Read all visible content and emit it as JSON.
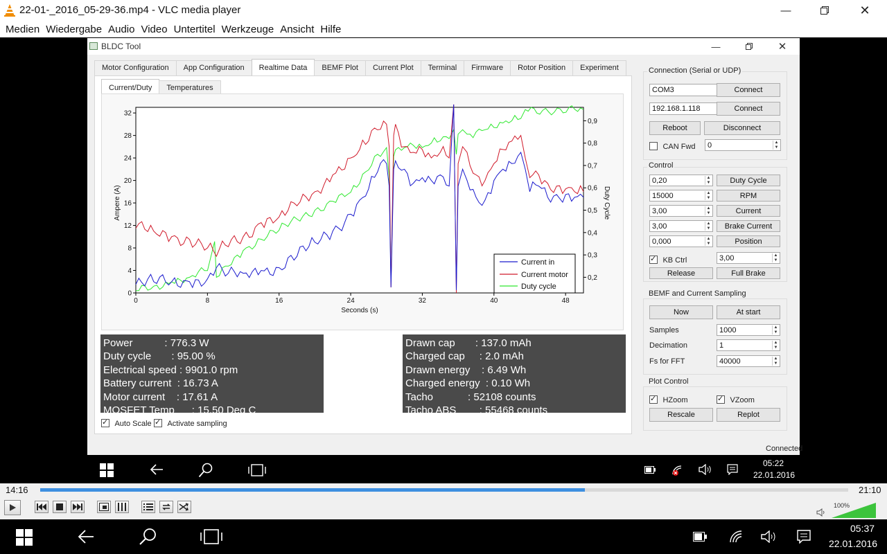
{
  "vlc": {
    "title": "22-01-_2016_05-29-36.mp4 - VLC media player",
    "menu": [
      "Medien",
      "Wiedergabe",
      "Audio",
      "Video",
      "Untertitel",
      "Werkzeuge",
      "Ansicht",
      "Hilfe"
    ],
    "time_elapsed": "14:16",
    "time_total": "21:10",
    "progress_fraction": 0.674,
    "volume_label": "100%",
    "volume_fraction": 1.0
  },
  "bldc": {
    "title": "BLDC Tool",
    "main_tabs": [
      "Motor Configuration",
      "App Configuration",
      "Realtime Data",
      "BEMF Plot",
      "Current Plot",
      "Terminal",
      "Firmware",
      "Rotor Position",
      "Experiment"
    ],
    "active_main_tab": "Realtime Data",
    "sub_tabs": [
      "Current/Duty",
      "Temperatures"
    ],
    "active_sub_tab": "Current/Duty",
    "stats_left": [
      "Power           : 776.3 W",
      "Duty cycle       : 95.00 %",
      "Electrical speed : 9901.0 rpm",
      "Battery current  : 16.73 A",
      "Motor current    : 17.61 A",
      "MOSFET Temp      : 15.50 Deg C"
    ],
    "stats_right": [
      "Drawn cap       : 137.0 mAh",
      "Charged cap     : 2.0 mAh",
      "Drawn energy    : 6.49 Wh",
      "Charged energy  : 0.10 Wh",
      "Tacho            : 52108 counts",
      "Tacho ABS        : 55468 counts"
    ],
    "auto_scale_label": "Auto Scale",
    "activate_sampling_label": "Activate sampling",
    "connection": {
      "title": "Connection (Serial or UDP)",
      "port_value": "COM3",
      "ip_value": "192.168.1.118",
      "connect_label": "Connect",
      "reboot_label": "Reboot",
      "disconnect_label": "Disconnect",
      "can_fwd_label": "CAN Fwd",
      "can_fwd_value": "0"
    },
    "control": {
      "title": "Control",
      "rows": [
        {
          "value": "0,20",
          "button": "Duty Cycle"
        },
        {
          "value": "15000",
          "button": "RPM"
        },
        {
          "value": "3,00",
          "button": "Current"
        },
        {
          "value": "3,00",
          "button": "Brake Current"
        },
        {
          "value": "0,000",
          "button": "Position"
        }
      ],
      "kb_ctrl_label": "KB Ctrl",
      "kb_ctrl_value": "3,00",
      "release_label": "Release",
      "full_brake_label": "Full Brake"
    },
    "sampling": {
      "title": "BEMF and Current Sampling",
      "now_label": "Now",
      "at_start_label": "At start",
      "samples_label": "Samples",
      "samples_value": "1000",
      "decimation_label": "Decimation",
      "decimation_value": "1",
      "fs_label": "Fs for FFT",
      "fs_value": "40000"
    },
    "plot_control": {
      "title": "Plot Control",
      "hzoom_label": "HZoom",
      "vzoom_label": "VZoom",
      "rescale_label": "Rescale",
      "replot_label": "Replot"
    },
    "status": "Connected"
  },
  "inner_taskbar": {
    "time": "05:22",
    "date": "22.01.2016"
  },
  "win_taskbar": {
    "time": "05:37",
    "date": "22.01.2016"
  },
  "colors": {
    "current_in": "#1a1acd",
    "current_motor": "#d01a2a",
    "duty_cycle": "#2ee82e",
    "seek": "#3d8fe0"
  },
  "chart_data": {
    "type": "line",
    "xlabel": "Seconds (s)",
    "ylabel": "Ampere (A)",
    "y2label": "Duty Cycle",
    "xlim": [
      0,
      50
    ],
    "ylim": [
      0,
      33
    ],
    "y2lim": [
      0.13,
      0.96
    ],
    "x_ticks": [
      "0",
      "8",
      "16",
      "24",
      "32",
      "40",
      "48"
    ],
    "y_ticks": [
      "0",
      "4",
      "8",
      "12",
      "16",
      "20",
      "24",
      "28",
      "32"
    ],
    "y2_ticks": [
      "0,2",
      "0,3",
      "0,4",
      "0,5",
      "0,6",
      "0,7",
      "0,8",
      "0,9"
    ],
    "series": [
      {
        "name": "Current in",
        "axis": "left",
        "x": [
          0,
          2,
          4,
          6,
          8,
          9,
          10,
          12,
          14,
          16,
          18,
          20,
          22,
          24,
          25,
          26,
          27,
          28,
          28.3,
          28.5,
          28.8,
          29,
          30,
          31,
          32,
          33,
          34,
          35,
          35.5,
          35.8,
          36,
          36.5,
          37,
          38,
          39,
          40,
          41,
          42,
          43,
          43.5,
          44,
          45,
          46,
          47,
          48,
          49,
          50
        ],
        "y": [
          1.5,
          2,
          2,
          2,
          2.5,
          4.5,
          3,
          3.5,
          4,
          4.5,
          6.5,
          9,
          11,
          14,
          16.5,
          18.5,
          21.5,
          23,
          19,
          1,
          22,
          23.5,
          22,
          19.5,
          20.5,
          20,
          21,
          19,
          33.5,
          0.5,
          19,
          22,
          20,
          17,
          16.5,
          20,
          22,
          23,
          25,
          22,
          18,
          19,
          17,
          17.5,
          17.5,
          17,
          17
        ]
      },
      {
        "name": "Current motor",
        "axis": "left",
        "x": [
          0,
          2,
          4,
          6,
          8,
          9,
          10,
          12,
          14,
          16,
          18,
          20,
          22,
          24,
          25,
          26,
          27,
          28,
          28.3,
          28.5,
          28.8,
          29,
          30,
          31,
          32,
          33,
          34,
          35,
          35.5,
          35.8,
          36,
          36.5,
          37,
          38,
          39,
          40,
          41,
          42,
          43,
          43.5,
          44,
          45,
          46,
          47,
          48,
          49,
          50
        ],
        "y": [
          11.5,
          11,
          10,
          9.5,
          8,
          6.5,
          8.5,
          10,
          12.5,
          13.5,
          15.5,
          18,
          21,
          24,
          25.5,
          27,
          29,
          30,
          26,
          1,
          28,
          30,
          26,
          25,
          25.5,
          24,
          25,
          24,
          33.5,
          0,
          23,
          26,
          25,
          21,
          20,
          23,
          25.5,
          27,
          28,
          24,
          20.5,
          21,
          19.5,
          19,
          18.5,
          18,
          18
        ]
      },
      {
        "name": "Duty cycle",
        "axis": "right",
        "x": [
          0,
          2,
          4,
          6,
          8,
          8.8,
          9,
          10,
          12,
          14,
          16,
          18,
          20,
          22,
          24,
          25,
          26,
          27,
          28,
          28.3,
          28.5,
          28.8,
          29,
          30,
          31,
          32,
          33,
          34,
          35,
          35.5,
          35.8,
          36,
          36.5,
          37,
          38,
          39,
          40,
          41,
          42,
          43,
          43.5,
          50
        ],
        "y": [
          0.14,
          0.16,
          0.18,
          0.2,
          0.23,
          0.36,
          0.2,
          0.25,
          0.32,
          0.37,
          0.41,
          0.46,
          0.5,
          0.54,
          0.58,
          0.62,
          0.68,
          0.75,
          0.78,
          0.65,
          0.18,
          0.74,
          0.77,
          0.78,
          0.79,
          0.78,
          0.8,
          0.81,
          0.82,
          0.86,
          0.75,
          0.84,
          0.86,
          0.84,
          0.85,
          0.86,
          0.87,
          0.89,
          0.9,
          0.91,
          0.95,
          0.95
        ]
      }
    ],
    "legend": "bottom-right"
  }
}
